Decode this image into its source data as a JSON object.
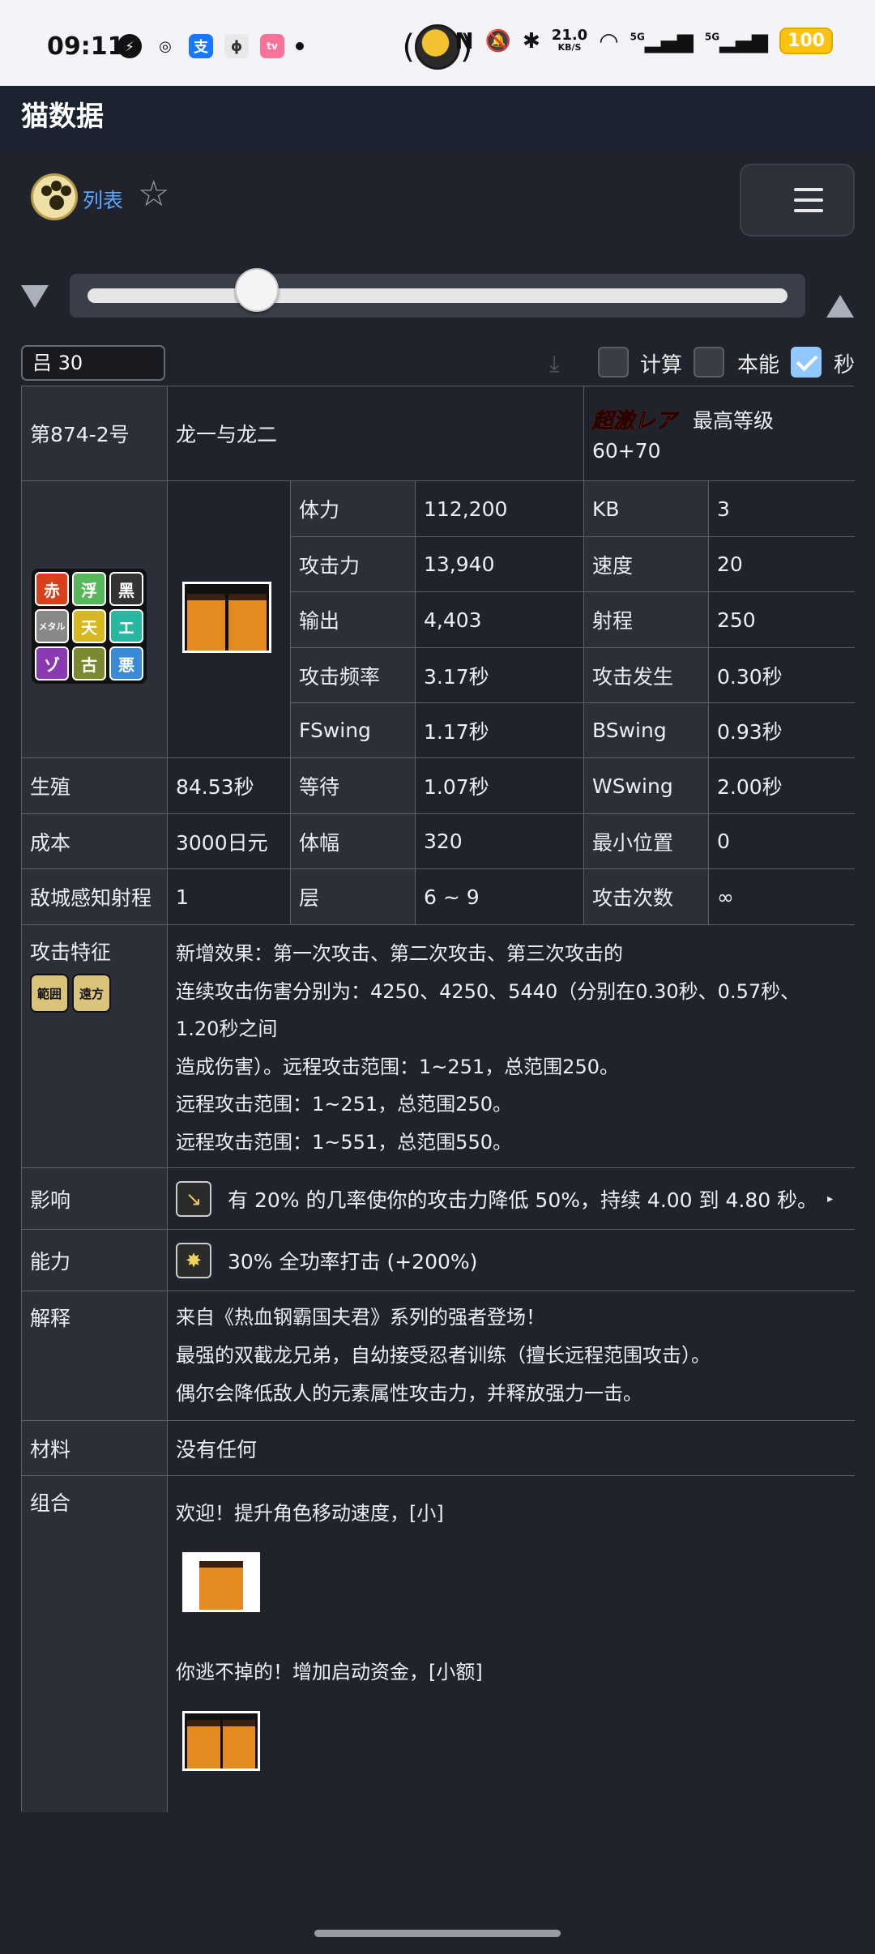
{
  "status_bar": {
    "time": "09:11",
    "net_speed": "21.0",
    "net_unit": "KB/S",
    "signal1": "5G",
    "signal2": "5G",
    "battery": "100"
  },
  "header": {
    "title": "猫数据"
  },
  "toolbar": {
    "list_label": "列表"
  },
  "level": {
    "value": "吕 30"
  },
  "checkboxes": [
    {
      "label": "计算",
      "checked": false
    },
    {
      "label": "本能",
      "checked": false
    },
    {
      "label": "秒",
      "checked": true
    }
  ],
  "unit": {
    "id": "第874-2号",
    "name": "龙一与龙二",
    "rarity": "超激レア",
    "max_level_label": "最高等级",
    "max_level": "60+70"
  },
  "traits": [
    "赤",
    "浮",
    "黑",
    "メタル",
    "天",
    "エ",
    "ゾ",
    "古",
    "悪"
  ],
  "stats": {
    "hp_label": "体力",
    "hp": "112,200",
    "kb_label": "KB",
    "kb": "3",
    "atk_label": "攻击力",
    "atk": "13,940",
    "speed_label": "速度",
    "speed": "20",
    "dps_label": "输出",
    "dps": "4,403",
    "range_label": "射程",
    "range": "250",
    "freq_label": "攻击频率",
    "freq": "3.17秒",
    "foreswing_label": "攻击发生",
    "foreswing": "0.30秒",
    "fswing_label": "FSwing",
    "fswing": "1.17秒",
    "bswing_label": "BSwing",
    "bswing": "0.93秒",
    "spawn_label": "生殖",
    "spawn": "84.53秒",
    "wait_label": "等待",
    "wait": "1.07秒",
    "wswing_label": "WSwing",
    "wswing": "2.00秒",
    "cost_label": "成本",
    "cost": "3000日元",
    "width_label": "体幅",
    "width": "320",
    "minpos_label": "最小位置",
    "minpos": "0",
    "sense_label": "敌城感知射程",
    "sense": "1",
    "layer_label": "层",
    "layer": "6 ~ 9",
    "hits_label": "攻击次数",
    "hits": "∞"
  },
  "attack_feature": {
    "label": "攻击特征",
    "tags": [
      "範囲",
      "遠方"
    ],
    "lines": [
      "新增效果：第一次攻击、第二次攻击、第三次攻击的",
      "连续攻击伤害分别为：4250、4250、5440（分别在0.30秒、0.57秒、",
      "1.20秒之间",
      "造成伤害）。远程攻击范围：1~251，总范围250。",
      "远程攻击范围：1~251，总范围250。",
      "远程攻击范围：1~551，总范围550。"
    ]
  },
  "effect": {
    "label": "影响",
    "text": "有 20% 的几率使你的攻击力降低 50%，持续 4.00 到 4.80 秒。",
    "more": "▸"
  },
  "ability": {
    "label": "能力",
    "text": "30% 全功率打击 (+200%)"
  },
  "description": {
    "label": "解释",
    "lines": [
      "来自《热血钢霸国夫君》系列的强者登场！",
      "最强的双截龙兄弟，自幼接受忍者训练（擅长远程范围攻击）。",
      "偶尔会降低敌人的元素属性攻击力，并释放强力一击。"
    ]
  },
  "materials": {
    "label": "材料",
    "value": "没有任何"
  },
  "combos": {
    "label": "组合",
    "items": [
      {
        "text": "欢迎！提升角色移动速度，[小]"
      },
      {
        "text": "你逃不掉的！增加启动资金，[小额]"
      }
    ]
  },
  "colors": {
    "background": "#20232b",
    "header": "#1b2331",
    "label_cell": "#2c2f38",
    "accent": "#5aa8ff",
    "checkbox_on": "#90c8ff"
  }
}
